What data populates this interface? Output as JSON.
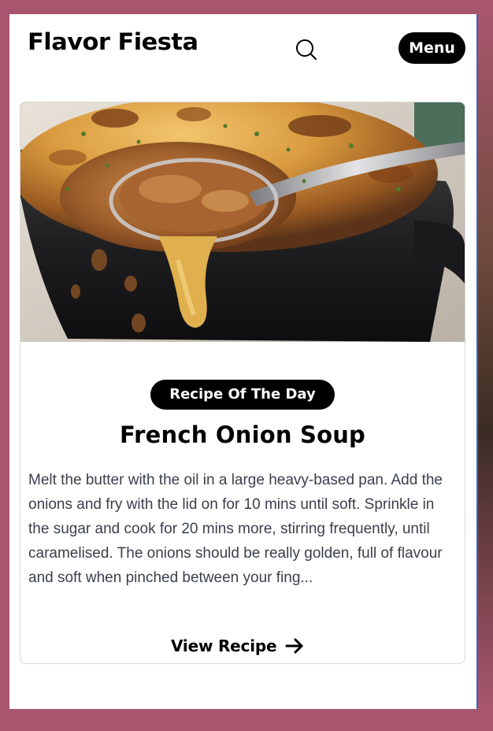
{
  "header": {
    "logo_text": "Flavor Fiesta",
    "search_icon": "search-icon",
    "menu_label": "Menu"
  },
  "card": {
    "image_subject": "french-onion-soup-photo",
    "badge_text": "Recipe Of The Day",
    "title": "French Onion Soup",
    "description": "Melt the butter with the oil in a large heavy-based pan. Add the onions and fry with the lid on for 10 mins until soft. Sprinkle in the sugar and cook for 20 mins more, stirring frequently, until caramelised. The onions should be really golden, full of flavour and soft when pinched between your fing...",
    "view_label": "View Recipe",
    "view_icon": "arrow-right-icon"
  },
  "colors": {
    "background": "#a8566e",
    "surface": "#ffffff",
    "primary": "#000000",
    "body_text": "#3a3f4b",
    "border": "#d9d9d9"
  }
}
